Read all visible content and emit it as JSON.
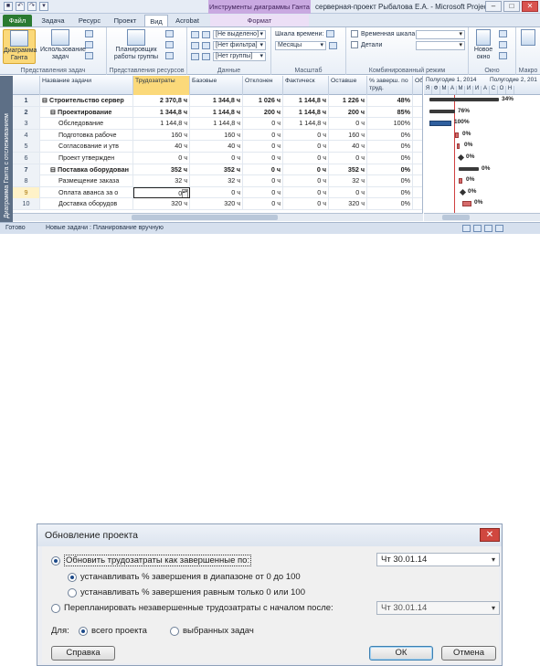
{
  "window": {
    "title": "серверная-проект Рыбалова Е.А.  -  Microsoft Project",
    "context_tool": "Инструменты диаграммы Ганта",
    "qat": [
      "save",
      "undo",
      "redo",
      "customize"
    ]
  },
  "tabs": {
    "file": "Файл",
    "task": "Задача",
    "resource": "Ресурс",
    "project": "Проект",
    "view": "Вид",
    "acrobat": "Acrobat",
    "format": "Формат"
  },
  "ribbon": {
    "task_views": {
      "label": "Представления задач",
      "gantt": "Диаграмма Ганта",
      "task_usage": "Использование задач"
    },
    "resource_views": {
      "label": "Представления ресурсов",
      "team_planner": "Планировщик работы группы"
    },
    "data": {
      "label": "Данные",
      "highlight": "[Не выделено]",
      "filter": "[Нет фильтра]",
      "group": "[Нет группы]"
    },
    "zoom": {
      "label": "Масштаб",
      "timescale_label": "Шкала времени:",
      "timescale_value": "Месяцы"
    },
    "split_view": {
      "label": "Комбинированный режим",
      "timeline": "Временная шкала",
      "details": "Детали"
    },
    "window": {
      "label": "Окно",
      "new_window": "Новое окно"
    },
    "macros": {
      "label": "Макро"
    }
  },
  "sidebar_label": "Диаграмма Ганта с отслеживанием",
  "grid": {
    "columns": [
      "Название задачи",
      "Трудозатраты",
      "Базовые",
      "Отклонен",
      "Фактическ",
      "Оставше",
      "% заверш. по труд.",
      "Об"
    ],
    "rows": [
      {
        "id": "1",
        "name": "Строительство сервер",
        "work": "2 370,8 ч",
        "baseline": "1 344,8 ч",
        "variance": "1 026 ч",
        "actual": "1 144,8 ч",
        "remaining": "1 226 ч",
        "pct": "48%",
        "indent": 0,
        "summary": true
      },
      {
        "id": "2",
        "name": "Проектирование",
        "work": "1 344,8 ч",
        "baseline": "1 144,8 ч",
        "variance": "200 ч",
        "actual": "1 144,8 ч",
        "remaining": "200 ч",
        "pct": "85%",
        "indent": 1,
        "summary": true
      },
      {
        "id": "3",
        "name": "Обследование",
        "work": "1 144,8 ч",
        "baseline": "1 144,8 ч",
        "variance": "0 ч",
        "actual": "1 144,8 ч",
        "remaining": "0 ч",
        "pct": "100%",
        "indent": 2,
        "summary": false
      },
      {
        "id": "4",
        "name": "Подготовка рабоче",
        "work": "160 ч",
        "baseline": "160 ч",
        "variance": "0 ч",
        "actual": "0 ч",
        "remaining": "160 ч",
        "pct": "0%",
        "indent": 2,
        "summary": false
      },
      {
        "id": "5",
        "name": "Согласование и утв",
        "work": "40 ч",
        "baseline": "40 ч",
        "variance": "0 ч",
        "actual": "0 ч",
        "remaining": "40 ч",
        "pct": "0%",
        "indent": 2,
        "summary": false
      },
      {
        "id": "6",
        "name": "Проект утвержден",
        "work": "0 ч",
        "baseline": "0 ч",
        "variance": "0 ч",
        "actual": "0 ч",
        "remaining": "0 ч",
        "pct": "0%",
        "indent": 2,
        "summary": false
      },
      {
        "id": "7",
        "name": "Поставка оборудован",
        "work": "352 ч",
        "baseline": "352 ч",
        "variance": "0 ч",
        "actual": "0 ч",
        "remaining": "352 ч",
        "pct": "0%",
        "indent": 1,
        "summary": true
      },
      {
        "id": "8",
        "name": "Размещение заказа",
        "work": "32 ч",
        "baseline": "32 ч",
        "variance": "0 ч",
        "actual": "0 ч",
        "remaining": "32 ч",
        "pct": "0%",
        "indent": 2,
        "summary": false
      },
      {
        "id": "9",
        "name": "Оплата аванса за о",
        "work": "0 ч",
        "baseline": "0 ч",
        "variance": "0 ч",
        "actual": "0 ч",
        "remaining": "0 ч",
        "pct": "0%",
        "indent": 2,
        "summary": false,
        "selected": true
      },
      {
        "id": "10",
        "name": "Доставка оборудов",
        "work": "320 ч",
        "baseline": "320 ч",
        "variance": "0 ч",
        "actual": "0 ч",
        "remaining": "320 ч",
        "pct": "0%",
        "indent": 2,
        "summary": false
      }
    ]
  },
  "gantt": {
    "period1": "Полугодие 1, 2014",
    "period2": "Полугодие 2, 201",
    "months": [
      "Я",
      "Ф",
      "М",
      "А",
      "М",
      "И",
      "И",
      "А",
      "С",
      "О",
      "Н"
    ],
    "labels": [
      "34%",
      "76%",
      "100%",
      "0%",
      "0%",
      "0%",
      "0%",
      "0%",
      "0%",
      "0%"
    ]
  },
  "status": {
    "ready": "Готово",
    "new_tasks": "Новые задачи : Планирование вручную"
  },
  "dialog": {
    "title": "Обновление проекта",
    "opt_update": "Обновить трудозатраты как завершенные по:",
    "update_date": "Чт 30.01.14",
    "opt_range": "устанавливать % завершения в диапазоне от 0 до 100",
    "opt_binary": "устанавливать % завершения равным только 0 или 100",
    "opt_reschedule": "Перепланировать незавершенные трудозатраты с началом после:",
    "reschedule_date": "Чт 30.01.14",
    "for_label": "Для:",
    "opt_entire": "всего проекта",
    "opt_selected": "выбранных задач",
    "help": "Справка",
    "ok": "ОК",
    "cancel": "Отмена"
  }
}
